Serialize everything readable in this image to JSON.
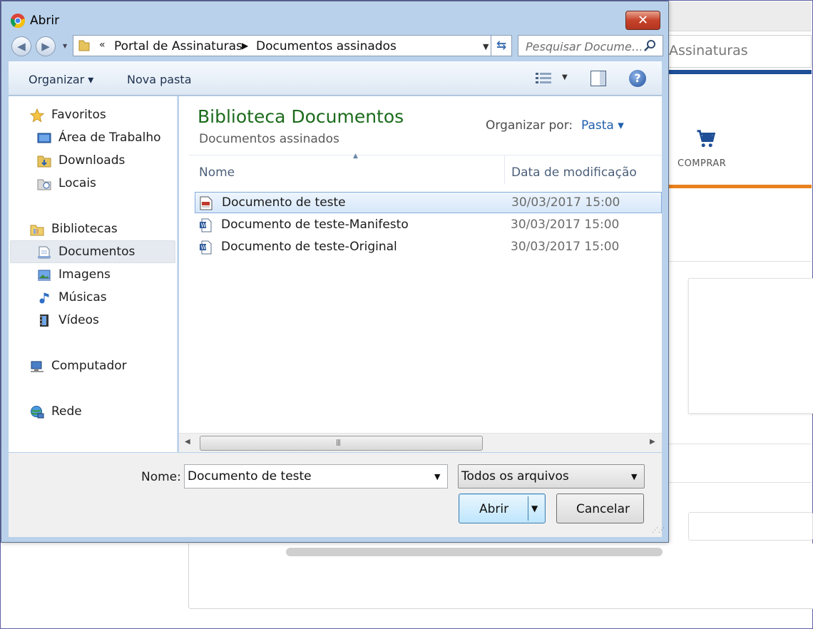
{
  "background": {
    "address_partial": "Assinaturas",
    "comprar_label": "COMPRAR",
    "colors": {
      "nav_blue": "#1f4f96",
      "accent_orange": "#e8821e"
    }
  },
  "dialog": {
    "title": "Abrir",
    "close_glyph": "✕",
    "nav": {
      "back_glyph": "◀",
      "forward_glyph": "▶",
      "breadcrumb_chevron": "«",
      "breadcrumb": [
        "Portal de Assinaturas",
        "Documentos assinados"
      ],
      "separator_glyph": "▶",
      "search_placeholder": "Pesquisar Docume…"
    },
    "toolbar": {
      "organize": "Organizar ▾",
      "new_folder": "Nova pasta",
      "help": "?"
    },
    "sidebar": {
      "favorites": {
        "label": "Favoritos",
        "items": [
          "Área de Trabalho",
          "Downloads",
          "Locais"
        ]
      },
      "libraries": {
        "label": "Bibliotecas",
        "items": [
          "Documentos",
          "Imagens",
          "Músicas",
          "Vídeos"
        ]
      },
      "computer": "Computador",
      "network": "Rede"
    },
    "content": {
      "library_title": "Biblioteca Documentos",
      "library_subtitle": "Documentos assinados",
      "arrange_label": "Organizar por:",
      "arrange_value": "Pasta ▾",
      "columns": {
        "name": "Nome",
        "date": "Data de modificação"
      },
      "files": [
        {
          "name": "Documento de teste",
          "date": "30/03/2017 15:00"
        },
        {
          "name": "Documento de teste-Manifesto",
          "date": "30/03/2017 15:00"
        },
        {
          "name": "Documento de teste-Original",
          "date": "30/03/2017 15:00"
        }
      ]
    },
    "footer": {
      "name_label": "Nome:",
      "name_value": "Documento de teste",
      "file_type": "Todos os arquivos",
      "open": "Abrir",
      "cancel": "Cancelar"
    }
  }
}
